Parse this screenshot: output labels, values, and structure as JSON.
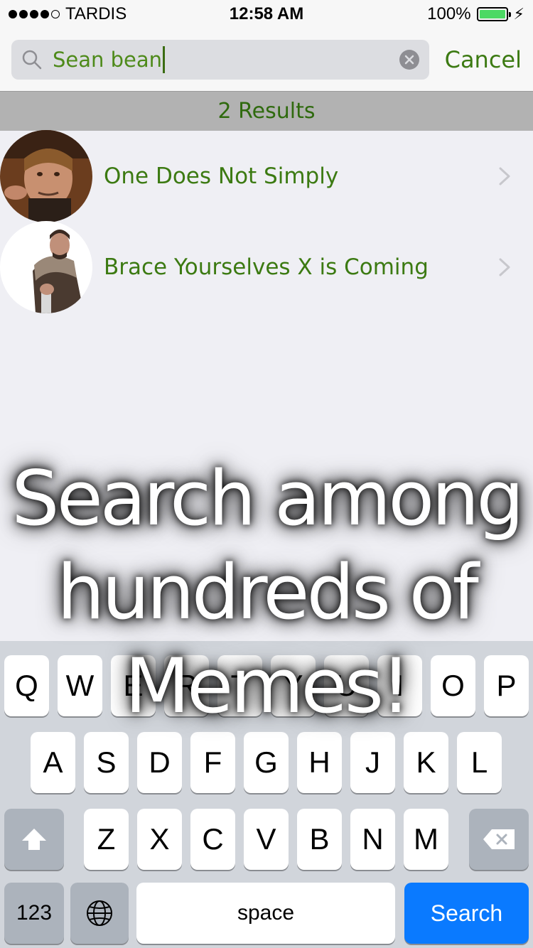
{
  "status_bar": {
    "carrier": "TARDIS",
    "time": "12:58 AM",
    "battery": "100%",
    "bolt": "⚡"
  },
  "search": {
    "value": "Sean bean",
    "cancel_label": "Cancel"
  },
  "results": {
    "count_label": "2 Results",
    "items": [
      {
        "title": "One Does Not Simply"
      },
      {
        "title": "Brace Yourselves X is Coming"
      }
    ]
  },
  "promo": {
    "line1": "Search among",
    "line2": "hundreds of",
    "line3": "Memes!"
  },
  "keyboard": {
    "row1": [
      "Q",
      "W",
      "E",
      "R",
      "T",
      "Y",
      "U",
      "I",
      "O",
      "P"
    ],
    "row2": [
      "A",
      "S",
      "D",
      "F",
      "G",
      "H",
      "J",
      "K",
      "L"
    ],
    "row3": [
      "Z",
      "X",
      "C",
      "V",
      "B",
      "N",
      "M"
    ],
    "numbers_label": "123",
    "space_label": "space",
    "search_label": "Search"
  },
  "colors": {
    "accent_green": "#3c7a12",
    "search_blue": "#0a7aff"
  }
}
